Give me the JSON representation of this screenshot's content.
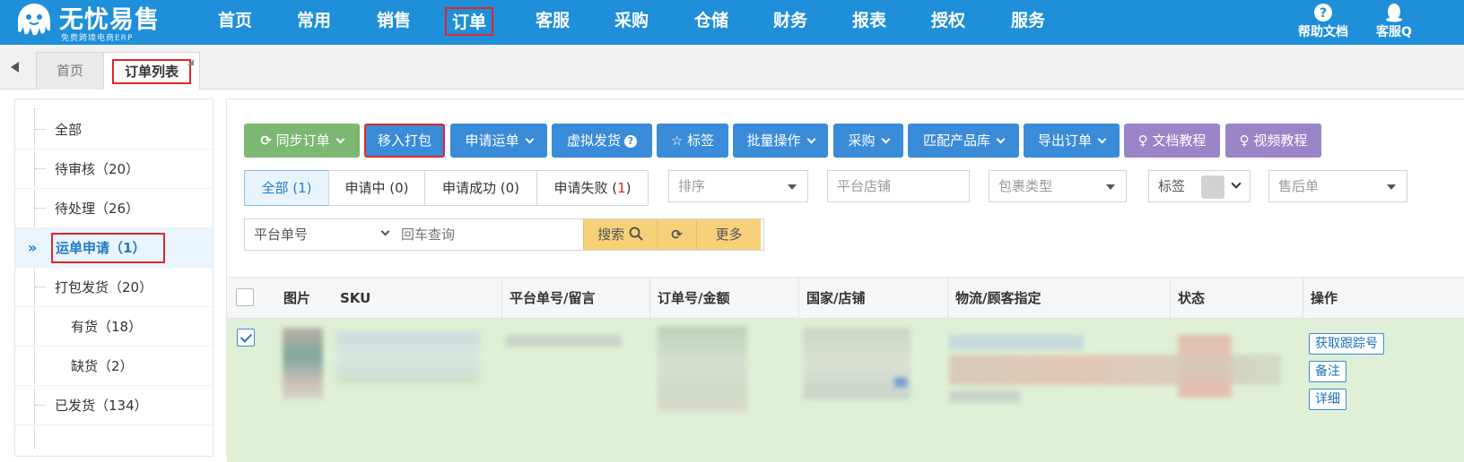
{
  "brand": {
    "title": "无忧易售",
    "subtitle": "免费跨境电商ERP"
  },
  "nav": {
    "items": [
      {
        "label": "首页"
      },
      {
        "label": "常用"
      },
      {
        "label": "销售"
      },
      {
        "label": "订单"
      },
      {
        "label": "客服"
      },
      {
        "label": "采购"
      },
      {
        "label": "仓储"
      },
      {
        "label": "财务"
      },
      {
        "label": "报表"
      },
      {
        "label": "授权"
      },
      {
        "label": "服务"
      }
    ],
    "help_label": "帮助文档",
    "service_label": "客服Q"
  },
  "tabs": [
    {
      "label": "首页"
    },
    {
      "label": "订单列表"
    }
  ],
  "sidebar": {
    "items": [
      {
        "label": "全部"
      },
      {
        "label": "待审核（20）"
      },
      {
        "label": "待处理（26）"
      },
      {
        "label": "运单申请（1）"
      },
      {
        "label": "打包发货（20）"
      },
      {
        "label": "有货（18）"
      },
      {
        "label": "缺货（2）"
      },
      {
        "label": "已发货（134）"
      }
    ]
  },
  "toolbar": {
    "sync": "同步订单",
    "move_pack": "移入打包",
    "apply_waybill": "申请运单",
    "virtual_ship": "虚拟发货",
    "tag": "标签",
    "batch": "批量操作",
    "purchase": "采购",
    "match_lib": "匹配产品库",
    "export": "导出订单",
    "doc_tutorial": "文档教程",
    "video_tutorial": "视频教程"
  },
  "filters": {
    "status_tabs": [
      {
        "text": "全部 ",
        "count": "(1)"
      },
      {
        "text": "申请中 (0)"
      },
      {
        "text": "申请成功 (0)"
      },
      {
        "text": "申请失败 (",
        "count": "1",
        "suffix": ")"
      }
    ],
    "sort_placeholder": "排序",
    "shop_placeholder": "平台店铺",
    "package_placeholder": "包裹类型",
    "tag_label": "标签",
    "aftersale_placeholder": "售后单"
  },
  "search": {
    "type_label": "平台单号",
    "placeholder": "回车查询",
    "search_label": "搜索",
    "more_label": "更多"
  },
  "table": {
    "columns": [
      "图片",
      "SKU",
      "平台单号/留言",
      "订单号/金额",
      "国家/店铺",
      "物流/顾客指定",
      "状态",
      "操作"
    ],
    "row_actions": [
      "获取跟踪号",
      "备注",
      "详细"
    ]
  },
  "colors": {
    "nav_bg": "#1e8fd8",
    "btn_blue": "#3a8bd8",
    "btn_green": "#7cb872",
    "btn_purple": "#9a85c8",
    "highlight_red": "#e0262a",
    "row_selected": "#dff0d6"
  }
}
